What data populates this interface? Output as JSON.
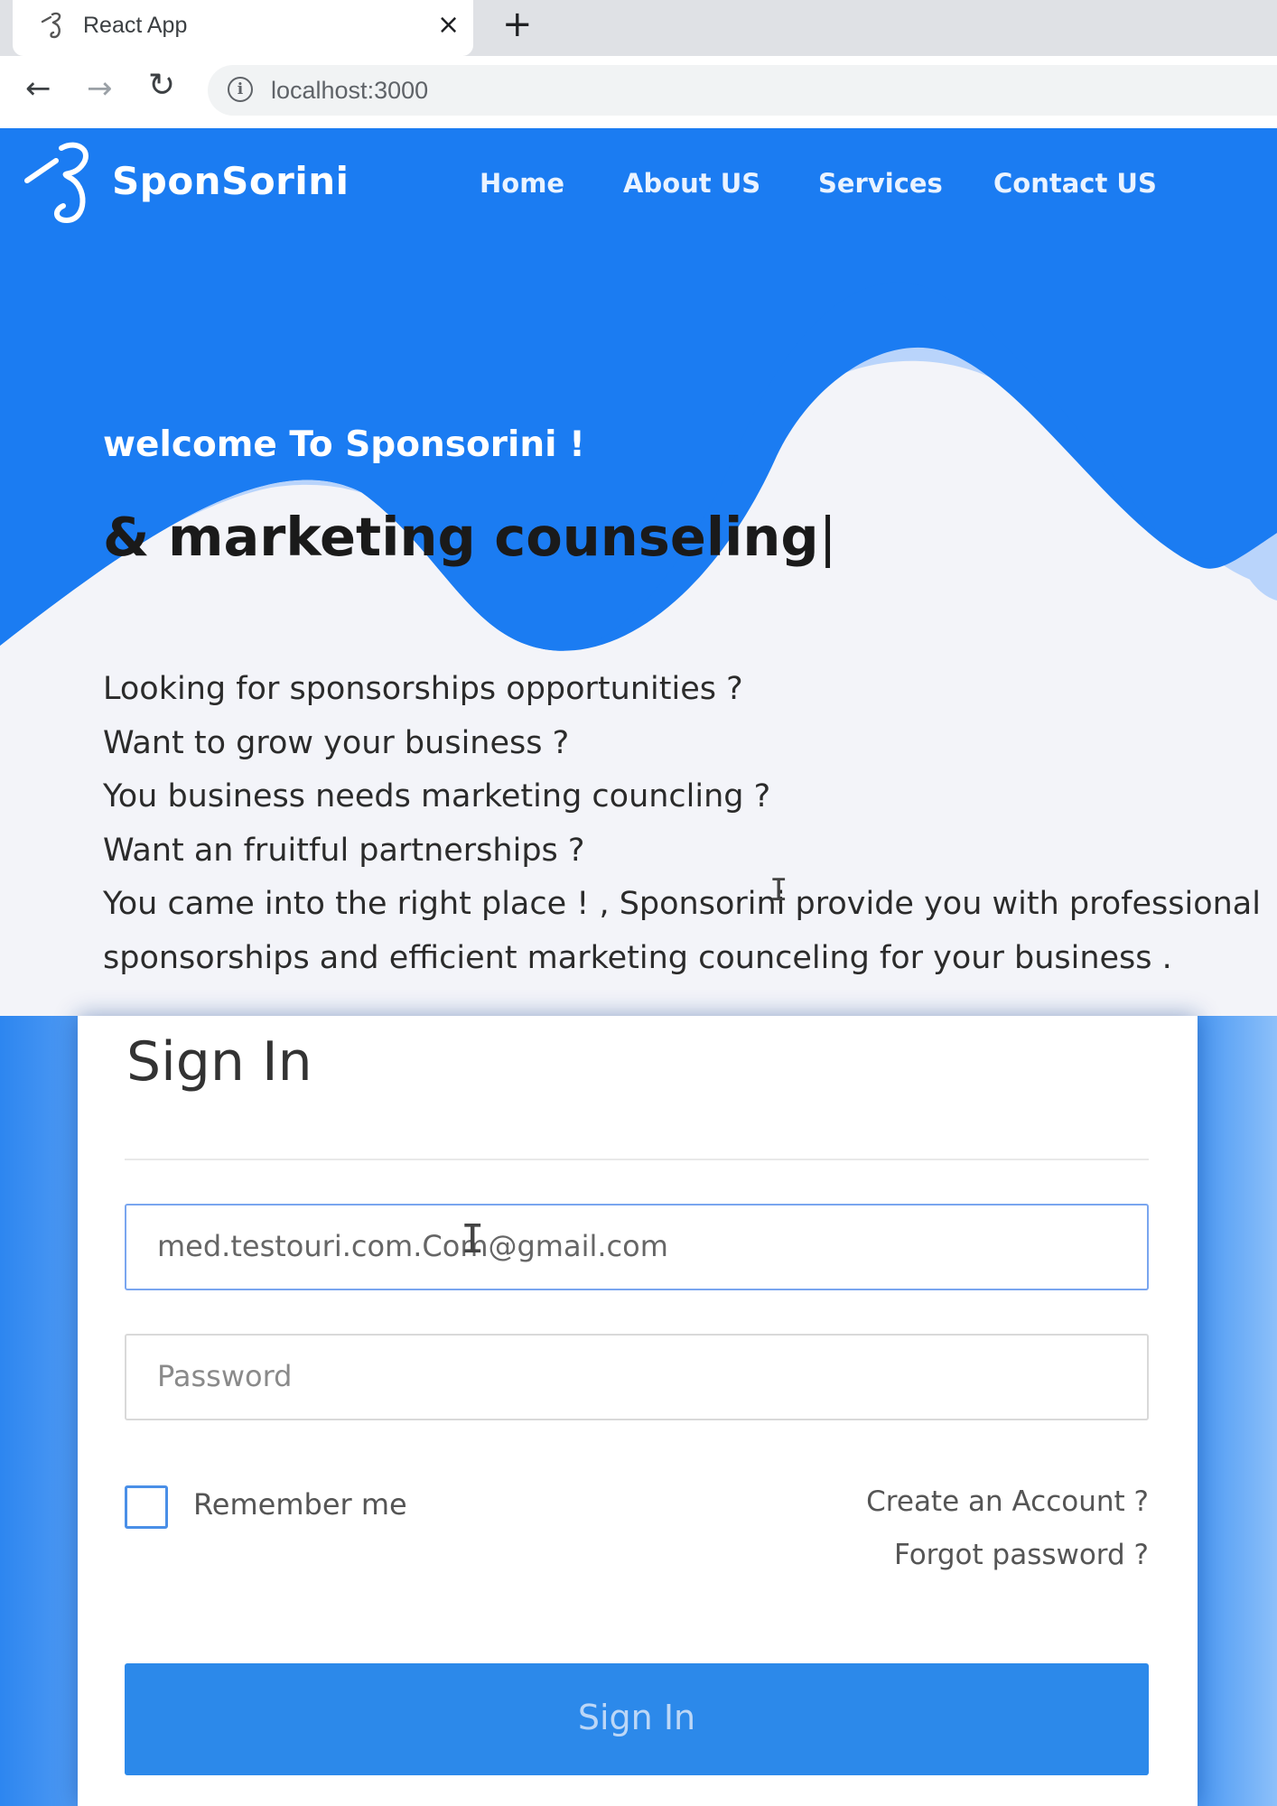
{
  "browser": {
    "tab_title": "React App",
    "tab_close": "×",
    "new_tab": "+",
    "nav": {
      "back": "←",
      "forward": "→",
      "reload": "↻"
    },
    "info_icon": "i",
    "url": "localhost:3000"
  },
  "navbar": {
    "brand": "SponSorini",
    "links": [
      "Home",
      "About US",
      "Services",
      "Contact US"
    ],
    "colors": {
      "primary": "#1b7cf2",
      "wave_light": "#b9d4fb"
    }
  },
  "hero": {
    "welcome": "welcome To Sponsorini !",
    "typed_text": "& marketing counseling",
    "caret": "|",
    "lines": [
      "Looking for sponsorships opportunities ?",
      "Want to grow your business ?",
      "You business needs marketing councling ?",
      "Want an fruitful partnerships ?"
    ],
    "paragraph": "You came into the right place ! , Sponsorini provide you with professional sponsorships and efficient marketing counceling for your business ."
  },
  "signin": {
    "title": "Sign In",
    "email_value": "med.testouri.com.Com@gmail.com",
    "password_placeholder": "Password",
    "remember_label": "Remember me",
    "remember_checked": false,
    "create_account": "Create an Account ?",
    "forgot_password": "Forgot password ?",
    "button_label": "Sign In",
    "colors": {
      "button": "#2c89ea",
      "checkbox_border": "#4a8fe7"
    }
  }
}
